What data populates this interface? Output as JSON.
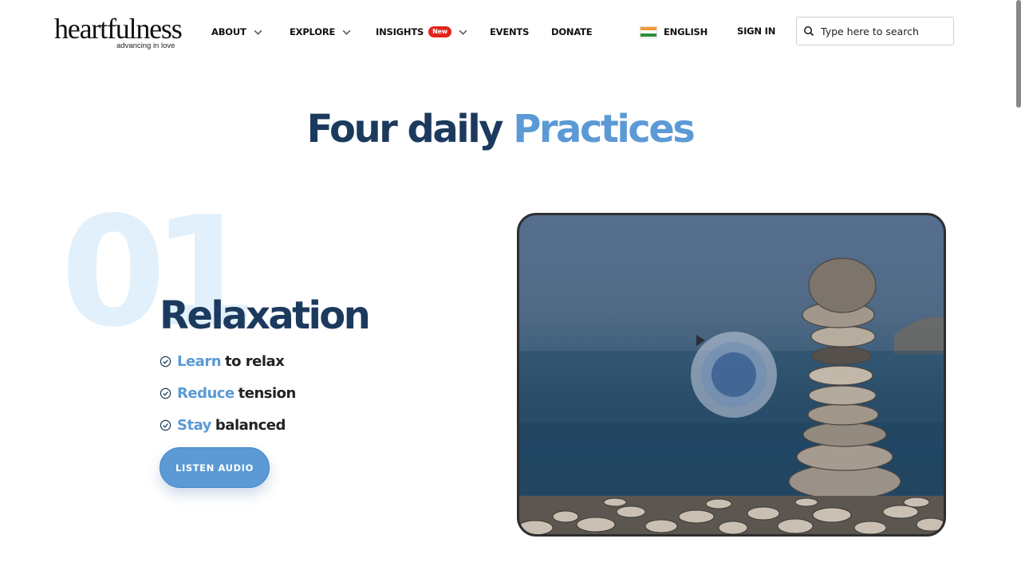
{
  "header": {
    "logo_text": "heartfulness",
    "logo_tagline": "advancing in love",
    "nav": [
      {
        "label": "ABOUT",
        "has_dropdown": true
      },
      {
        "label": "EXPLORE",
        "has_dropdown": true
      },
      {
        "label": "INSIGHTS",
        "badge": "New",
        "has_dropdown": true
      },
      {
        "label": "EVENTS"
      },
      {
        "label": "DONATE"
      }
    ],
    "language": "ENGLISH",
    "sign_in": "SIGN IN",
    "search_placeholder": "Type here to search"
  },
  "section": {
    "title_a": "Four daily",
    "title_b": "Practices"
  },
  "practice": {
    "number": "01",
    "title": "Relaxation",
    "benefits": [
      {
        "highlight": "Learn",
        "rest": "to relax"
      },
      {
        "highlight": "Reduce",
        "rest": "tension"
      },
      {
        "highlight": "Stay",
        "rest": "balanced"
      }
    ],
    "button_label": "LISTEN AUDIO"
  },
  "colors": {
    "navy": "#1c3a5e",
    "accent_blue": "#5b9ad5",
    "badge_red": "#e3241b",
    "number_watermark": "#e1f0fa"
  },
  "icons": [
    "chevron-down-icon",
    "india-flag-icon",
    "search-icon",
    "check-circle-icon",
    "play-icon"
  ]
}
